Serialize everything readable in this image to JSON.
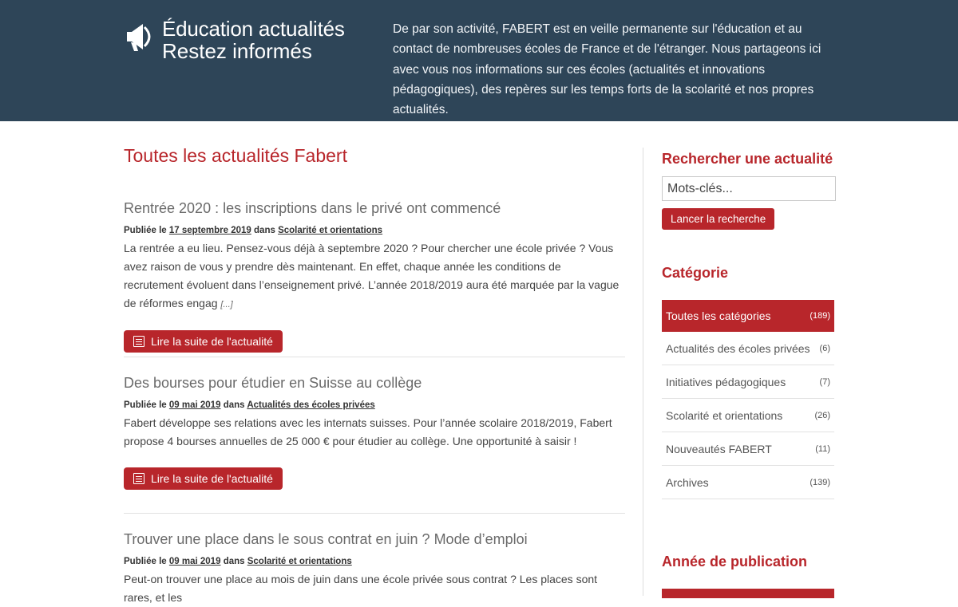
{
  "header": {
    "title": "Éducation actualités",
    "subtitle": "Restez informés",
    "description": "De par son activité, FABERT est en veille permanente sur l'éducation et au contact de nombreuses écoles de France et de l'étranger. Nous partageons ici avec vous nos informations sur ces écoles (actualités et innovations pédagogiques), des repères sur les temps forts de la scolarité et nos propres actualités."
  },
  "main": {
    "page_title": "Toutes les actualités Fabert",
    "published_label": "Publiée le",
    "in_label": "dans",
    "read_more_label": "Lire la suite de l'actualité",
    "articles": [
      {
        "title": "Rentrée 2020 : les inscriptions dans le privé ont commencé",
        "date": "17 septembre 2019",
        "category": "Scolarité et orientations",
        "excerpt": "La rentrée a eu lieu. Pensez-vous déjà à septembre 2020 ? Pour chercher une école privée ? Vous avez raison de vous y prendre dès maintenant. En effet, chaque année les conditions de recrutement évoluent dans l’enseignement privé. L’année 2018/2019 aura été marquée par la vague de réformes engag",
        "ellipsis": "[...]"
      },
      {
        "title": "Des bourses pour étudier en Suisse au collège",
        "date": "09 mai 2019",
        "category": "Actualités des écoles privées",
        "excerpt": "Fabert développe ses relations avec les internats suisses. Pour l’année scolaire 2018/2019, Fabert propose 4 bourses annuelles de 25 000 € pour étudier au collège. Une opportunité à saisir !",
        "ellipsis": ""
      },
      {
        "title": "Trouver une place dans le sous contrat en juin ? Mode d’emploi",
        "date": "09 mai 2019",
        "category": "Scolarité et orientations",
        "excerpt": "Peut-on trouver une place au mois de juin dans une école privée sous contrat ? Les places sont rares, et les",
        "ellipsis": ""
      }
    ]
  },
  "sidebar": {
    "search_title": "Rechercher une actualité",
    "search_placeholder": "Mots-clés...",
    "search_button": "Lancer la recherche",
    "category_title": "Catégorie",
    "categories": [
      {
        "label": "Toutes les catégories",
        "count": "(189)"
      },
      {
        "label": "Actualités des écoles privées",
        "count": "(6)"
      },
      {
        "label": "Initiatives pédagogiques",
        "count": "(7)"
      },
      {
        "label": "Scolarité et orientations",
        "count": "(26)"
      },
      {
        "label": "Nouveautés FABERT",
        "count": "(11)"
      },
      {
        "label": "Archives",
        "count": "(139)"
      }
    ],
    "year_title": "Année de publication"
  },
  "colors": {
    "header_bg": "#2e4558",
    "accent": "#b8262b"
  }
}
